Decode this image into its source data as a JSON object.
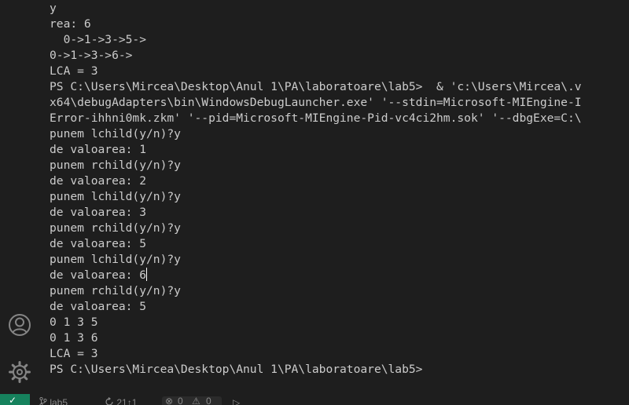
{
  "terminal": {
    "lines": [
      "y",
      "rea: 6",
      "  0->1->3->5->",
      "0->1->3->6->",
      "LCA = 3",
      "PS C:\\Users\\Mircea\\Desktop\\Anul 1\\PA\\laboratoare\\lab5>  & 'c:\\Users\\Mircea\\.v",
      "x64\\debugAdapters\\bin\\WindowsDebugLauncher.exe' '--stdin=Microsoft-MIEngine-I",
      "Error-ihhni0mk.zkm' '--pid=Microsoft-MIEngine-Pid-vc4ci2hm.sok' '--dbgExe=C:\\",
      "punem lchild(y/n)?y",
      "de valoarea: 1",
      "punem rchild(y/n)?y",
      "de valoarea: 2",
      "punem lchild(y/n)?y",
      "de valoarea: 3",
      "punem rchild(y/n)?y",
      "de valoarea: 5",
      "punem lchild(y/n)?y",
      "de valoarea: 6",
      "punem rchild(y/n)?y",
      "de valoarea: 5",
      "0 1 3 5",
      "0 1 3 6",
      "LCA = 3",
      "PS C:\\Users\\Mircea\\Desktop\\Anul 1\\PA\\laboratoare\\lab5>"
    ],
    "caret_line_index": 17,
    "text_color": "#cccccc",
    "background": "#1e1e1e"
  },
  "activity_bar": {
    "icons": [
      "account-icon",
      "settings-gear-icon"
    ],
    "icon_color": "#858585"
  },
  "status_bar": {
    "remote_glyph": "✓",
    "remote_color": "#16825d",
    "items": {
      "source_control": "lab5",
      "sync": "21↑1",
      "errors": "0",
      "warnings": "0"
    }
  }
}
